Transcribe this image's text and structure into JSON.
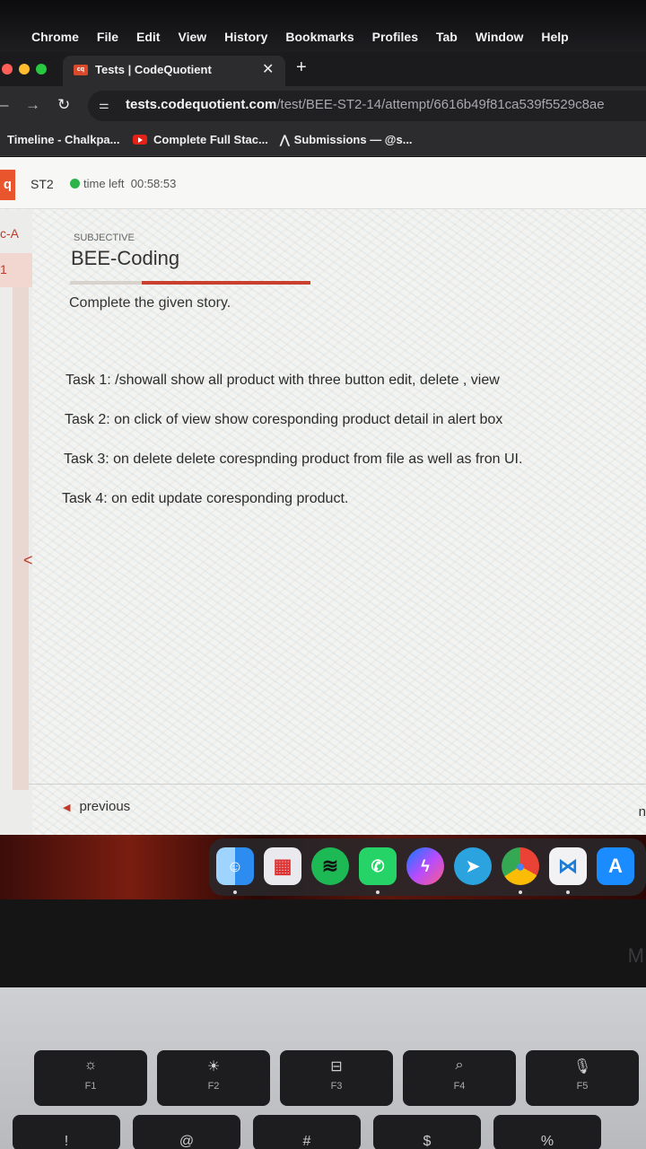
{
  "menubar": {
    "items": [
      "Chrome",
      "File",
      "Edit",
      "View",
      "History",
      "Bookmarks",
      "Profiles",
      "Tab",
      "Window",
      "Help"
    ]
  },
  "tab": {
    "favicon_text": "cq",
    "title": "Tests | CodeQuotient"
  },
  "address": {
    "host": "tests.codequotient.com",
    "path": "/test/BEE-ST2-14/attempt/6616b49f81ca539f5529c8ae"
  },
  "bookmarks": [
    "Timeline - Chalkpa...",
    "Complete Full Stac...",
    "Submissions — @s..."
  ],
  "header": {
    "test_code": "ST2",
    "time_left_label": "time left",
    "time_left_value": "00:58:53",
    "logo": "q"
  },
  "sidebar": {
    "label": "c-A",
    "active_number": "1"
  },
  "question": {
    "type_tag": "SUBJECTIVE",
    "title": "BEE-Coding",
    "description": "Complete the given story.",
    "tasks": [
      "Task 1: /showall show all product with three button edit, delete , view",
      "Task 2: on click of view show coresponding product detail in alert box",
      "Task 3: on delete delete corespnding product from file as well as fron UI.",
      "Task 4: on edit update coresponding product."
    ]
  },
  "footer": {
    "previous_label": "previous",
    "next_label": "n"
  },
  "dock": {
    "apps": [
      "finder-icon",
      "launchpad-icon",
      "spotify-icon",
      "whatsapp-icon",
      "messenger-icon",
      "telegram-icon",
      "chrome-icon",
      "vscode-icon",
      "app-store-icon"
    ]
  },
  "keyboard": {
    "keys": [
      {
        "label": "F1",
        "icon": "brightness-down-icon"
      },
      {
        "label": "F2",
        "icon": "brightness-up-icon"
      },
      {
        "label": "F3",
        "icon": "mission-control-icon"
      },
      {
        "label": "F4",
        "icon": "search-icon"
      },
      {
        "label": "F5",
        "icon": "dictation-icon"
      }
    ],
    "bezel_text": "M"
  },
  "colors": {
    "accent": "#c9402e",
    "status_green": "#2db34a",
    "logo_orange": "#e9552d"
  }
}
